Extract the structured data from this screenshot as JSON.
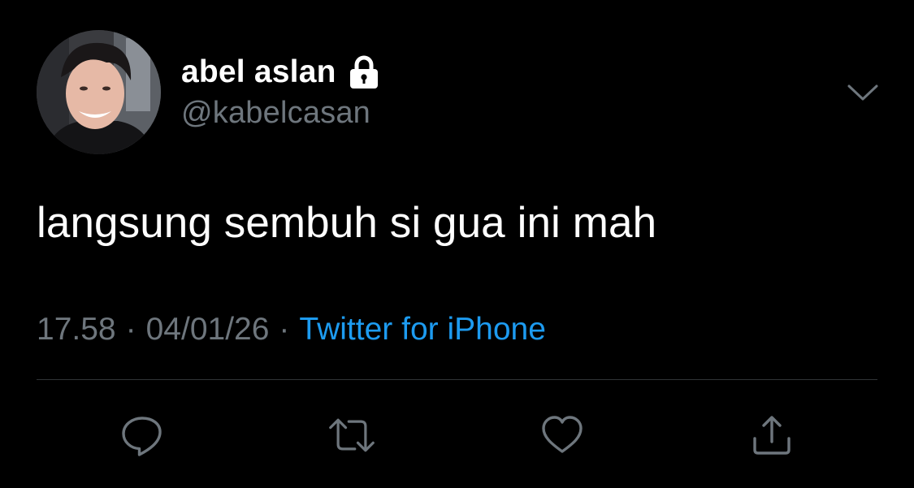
{
  "user": {
    "display_name": "abel aslan",
    "handle": "@kabelcasan",
    "protected_icon": "lock-icon",
    "avatar": "profile-photo"
  },
  "tweet": {
    "text": "langsung sembuh si gua ini mah"
  },
  "meta": {
    "time": "17.58",
    "separator": "·",
    "date": "04/01/26",
    "source": "Twitter for iPhone"
  },
  "actions": {
    "reply_icon": "reply-icon",
    "retweet_icon": "retweet-icon",
    "like_icon": "heart-icon",
    "share_icon": "share-icon",
    "more_icon": "chevron-down-icon"
  },
  "colors": {
    "background": "#000000",
    "primary_text": "#ffffff",
    "secondary_text": "#6e767d",
    "link": "#1d9bf0",
    "divider": "#2f3336"
  }
}
